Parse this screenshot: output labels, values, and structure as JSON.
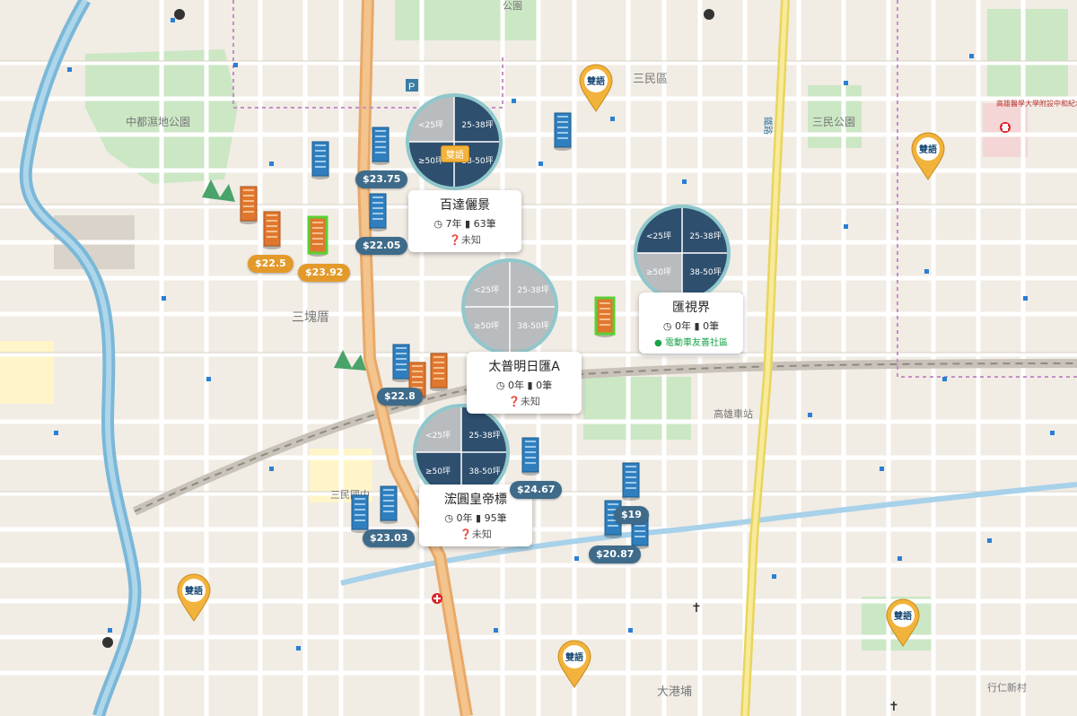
{
  "map": {
    "district_labels": [
      "中都濕地公園",
      "三塊厝",
      "三民區",
      "三民公園",
      "高雄車站",
      "大港埔",
      "三民國中",
      "公園",
      "行仁新村",
      "高雄醫學大學附設中和紀念醫院"
    ],
    "rail_label": "鐵路"
  },
  "listings": [
    {
      "id": "baida",
      "name": "百達儷景",
      "age": "7年",
      "count": "63筆",
      "status": "未知",
      "tag": "雙語",
      "pie": [
        "<25坪",
        "25-38坪",
        "≥50坪",
        "38-50坪"
      ]
    },
    {
      "id": "huishi",
      "name": "匯視界",
      "age": "0年",
      "count": "0筆",
      "badge": "電動車友善社區",
      "pie": [
        "<25坪",
        "25-38坪",
        "≥50坪",
        "38-50坪"
      ]
    },
    {
      "id": "taipu",
      "name": "太普明日匯A",
      "age": "0年",
      "count": "0筆",
      "status": "未知",
      "pie": [
        "<25坪",
        "25-38坪",
        "≥50坪",
        "38-50坪"
      ]
    },
    {
      "id": "hongyuan",
      "name": "浤圓皇帝標",
      "age": "0年",
      "count": "95筆",
      "status": "未知",
      "pie": [
        "<25坪",
        "25-38坪",
        "≥50坪",
        "38-50坪"
      ]
    }
  ],
  "prices": [
    "$23.75",
    "$22.05",
    "$22.5",
    "$23.92",
    "$22.8",
    "$24.67",
    "$23.03",
    "$20.87",
    "$19"
  ],
  "school_pins": [
    "雙語",
    "雙語",
    "雙語",
    "雙語",
    "雙語"
  ],
  "colors": {
    "dark_blue": "#2e4f6e",
    "grey": "#b9bcbe",
    "orange": "#e39a2a",
    "teal_ring": "#8fc8cc",
    "river": "#7ab8d9",
    "green_park": "#cbe7c4"
  }
}
